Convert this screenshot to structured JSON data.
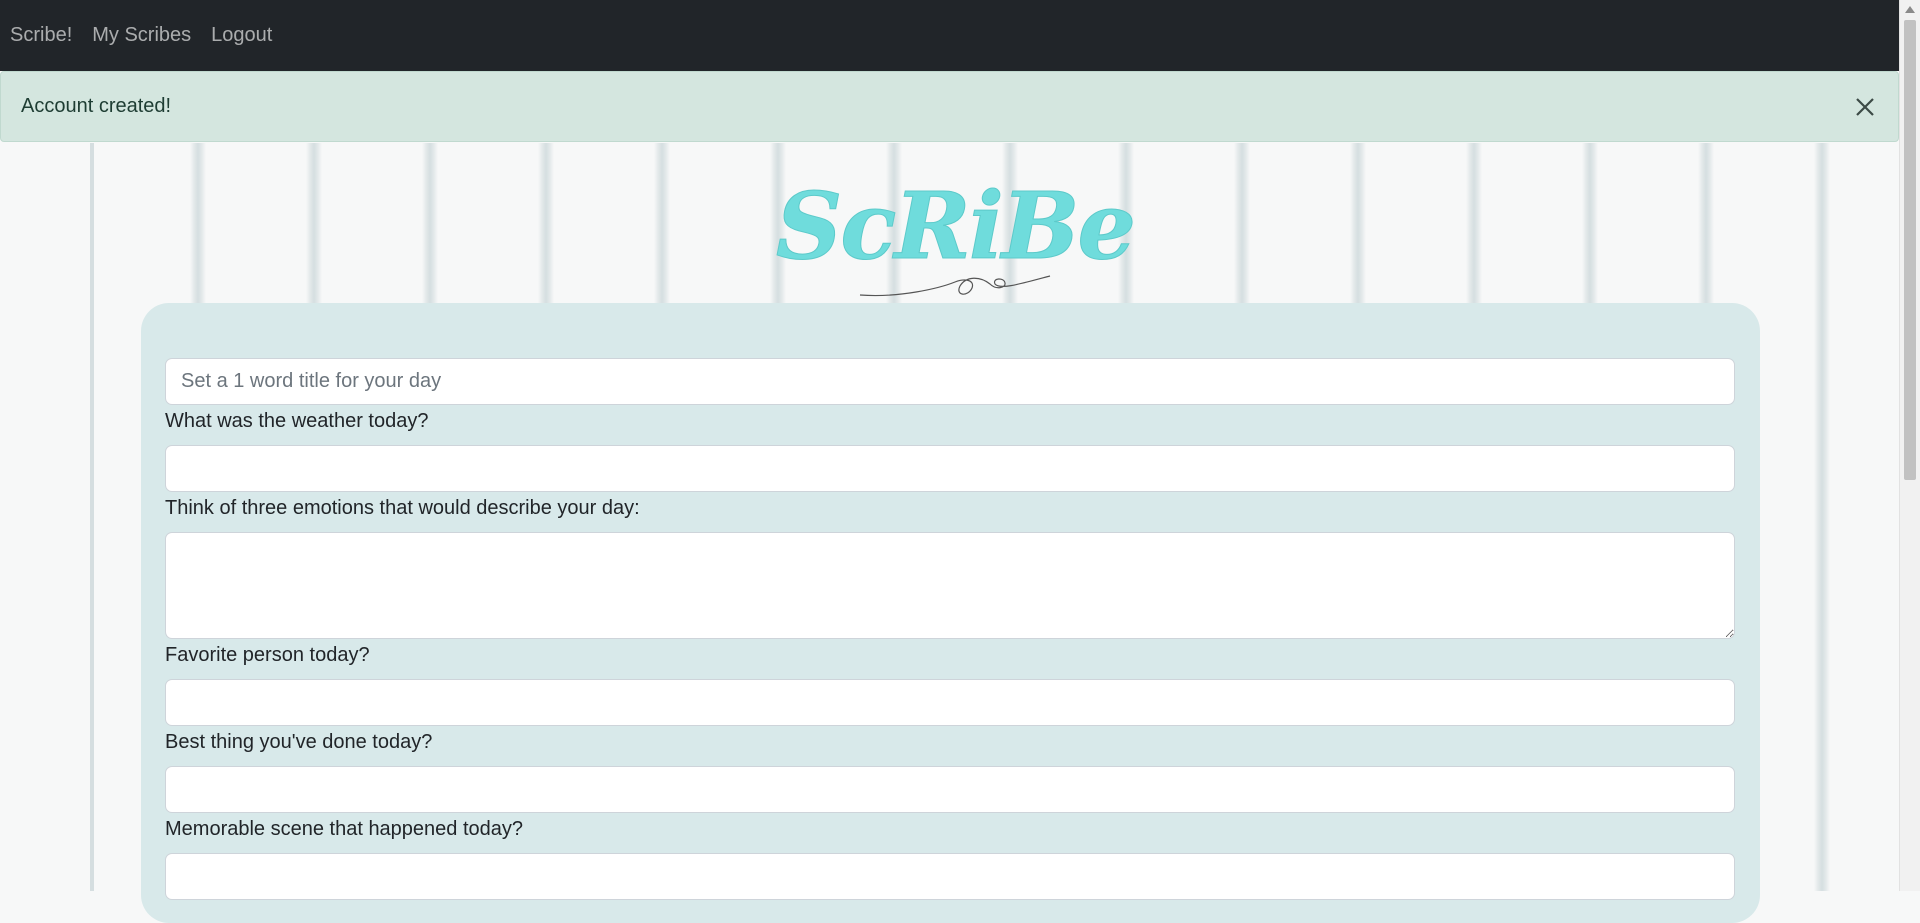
{
  "nav": {
    "brand": "Scribe!",
    "links": [
      "My Scribes",
      "Logout"
    ]
  },
  "alert": {
    "message": "Account created!",
    "close_icon": "close-icon"
  },
  "logo": {
    "text": "ScRiBe",
    "color": "#6fdcdc"
  },
  "form": {
    "title_placeholder": "Set a 1 word title for your day",
    "title_value": "",
    "weather_label": "What was the weather today?",
    "weather_value": "",
    "emotions_label": "Think of three emotions that would describe your day:",
    "emotions_value": "",
    "favorite_person_label": "Favorite person today?",
    "favorite_person_value": "",
    "best_thing_label": "Best thing you've done today?",
    "best_thing_value": "",
    "memorable_scene_label": "Memorable scene that happened today?",
    "memorable_scene_value": ""
  },
  "colors": {
    "navbar": "#212529",
    "alert_bg": "#d4e6df",
    "card_bg": "#d8e9ea",
    "logo": "#6fdcdc"
  }
}
